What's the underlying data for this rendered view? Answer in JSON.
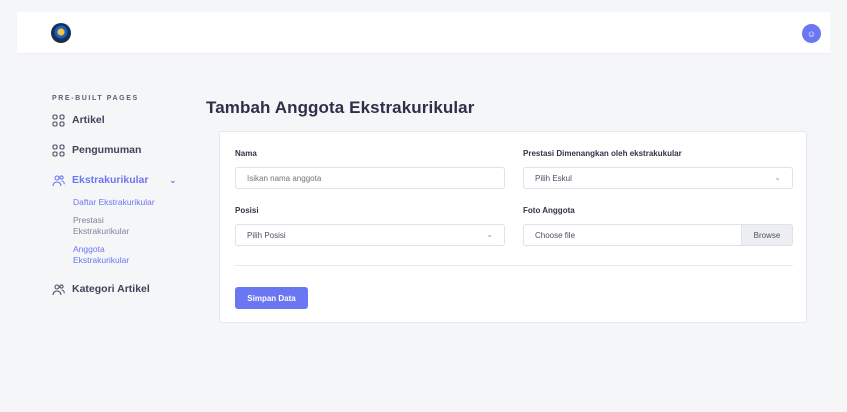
{
  "header": {
    "logo_icon": "emblem-logo",
    "avatar_icon": "user-icon"
  },
  "sidebar": {
    "section_label": "PRE-BUILT PAGES",
    "items": [
      {
        "label": "Artikel",
        "icon": "grid-icon"
      },
      {
        "label": "Pengumuman",
        "icon": "grid-icon"
      },
      {
        "label": "Ekstrakurikular",
        "icon": "users-icon",
        "active": true,
        "children": [
          "Daftar Ekstrakurikular",
          "Prestasi Ekstrakurikular",
          "Anggota Ekstrakurikular"
        ]
      },
      {
        "label": "Kategori Artikel",
        "icon": "users-icon"
      }
    ]
  },
  "main": {
    "title": "Tambah Anggota Ekstrakurikular",
    "form": {
      "nama": {
        "label": "Nama",
        "placeholder": "Isikan nama anggota"
      },
      "prestasi": {
        "label": "Prestasi Dimenangkan oleh ekstrakukular",
        "value": "Pilih Eskul"
      },
      "posisi": {
        "label": "Posisi",
        "value": "Pilih Posisi"
      },
      "foto": {
        "label": "Foto Anggota",
        "value": "Choose file",
        "browse": "Browse"
      },
      "submit": "Simpan Data"
    }
  },
  "colors": {
    "accent": "#6b76f2",
    "background": "#f5f6f8"
  }
}
